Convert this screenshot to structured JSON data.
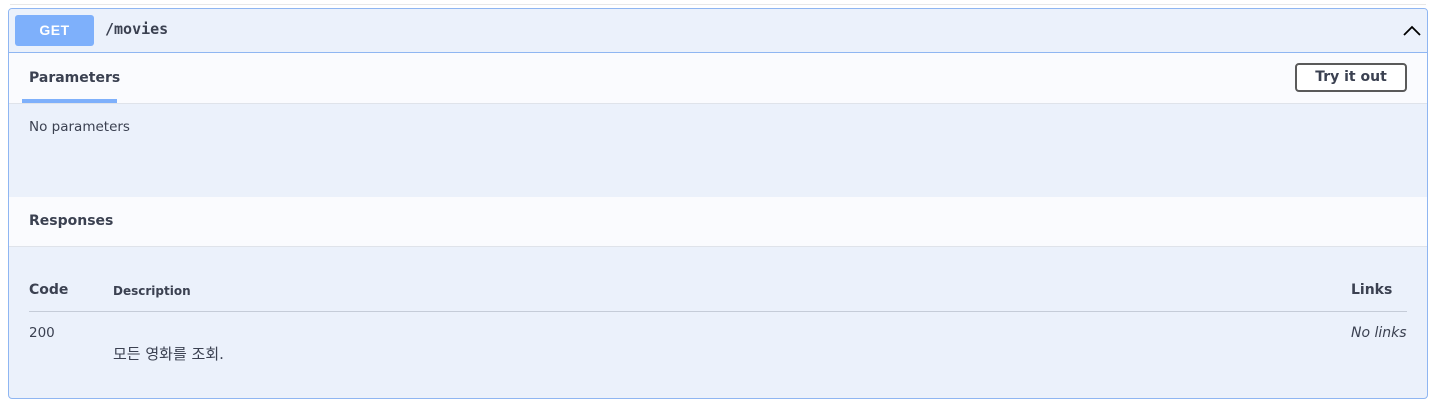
{
  "operation": {
    "method": "GET",
    "path": "/movies"
  },
  "parameters": {
    "tab_label": "Parameters",
    "try_it_out_label": "Try it out",
    "empty_text": "No parameters"
  },
  "responses": {
    "title": "Responses",
    "columns": {
      "code": "Code",
      "description": "Description",
      "links": "Links"
    },
    "rows": [
      {
        "code": "200",
        "description": "모든 영화를 조회.",
        "links": "No links"
      }
    ]
  },
  "colors": {
    "method_badge": "#7eb0fb",
    "block_background": "#ebf1fb",
    "block_border": "#8fb6f2"
  },
  "icons": {
    "collapse": "chevron-up-icon"
  }
}
